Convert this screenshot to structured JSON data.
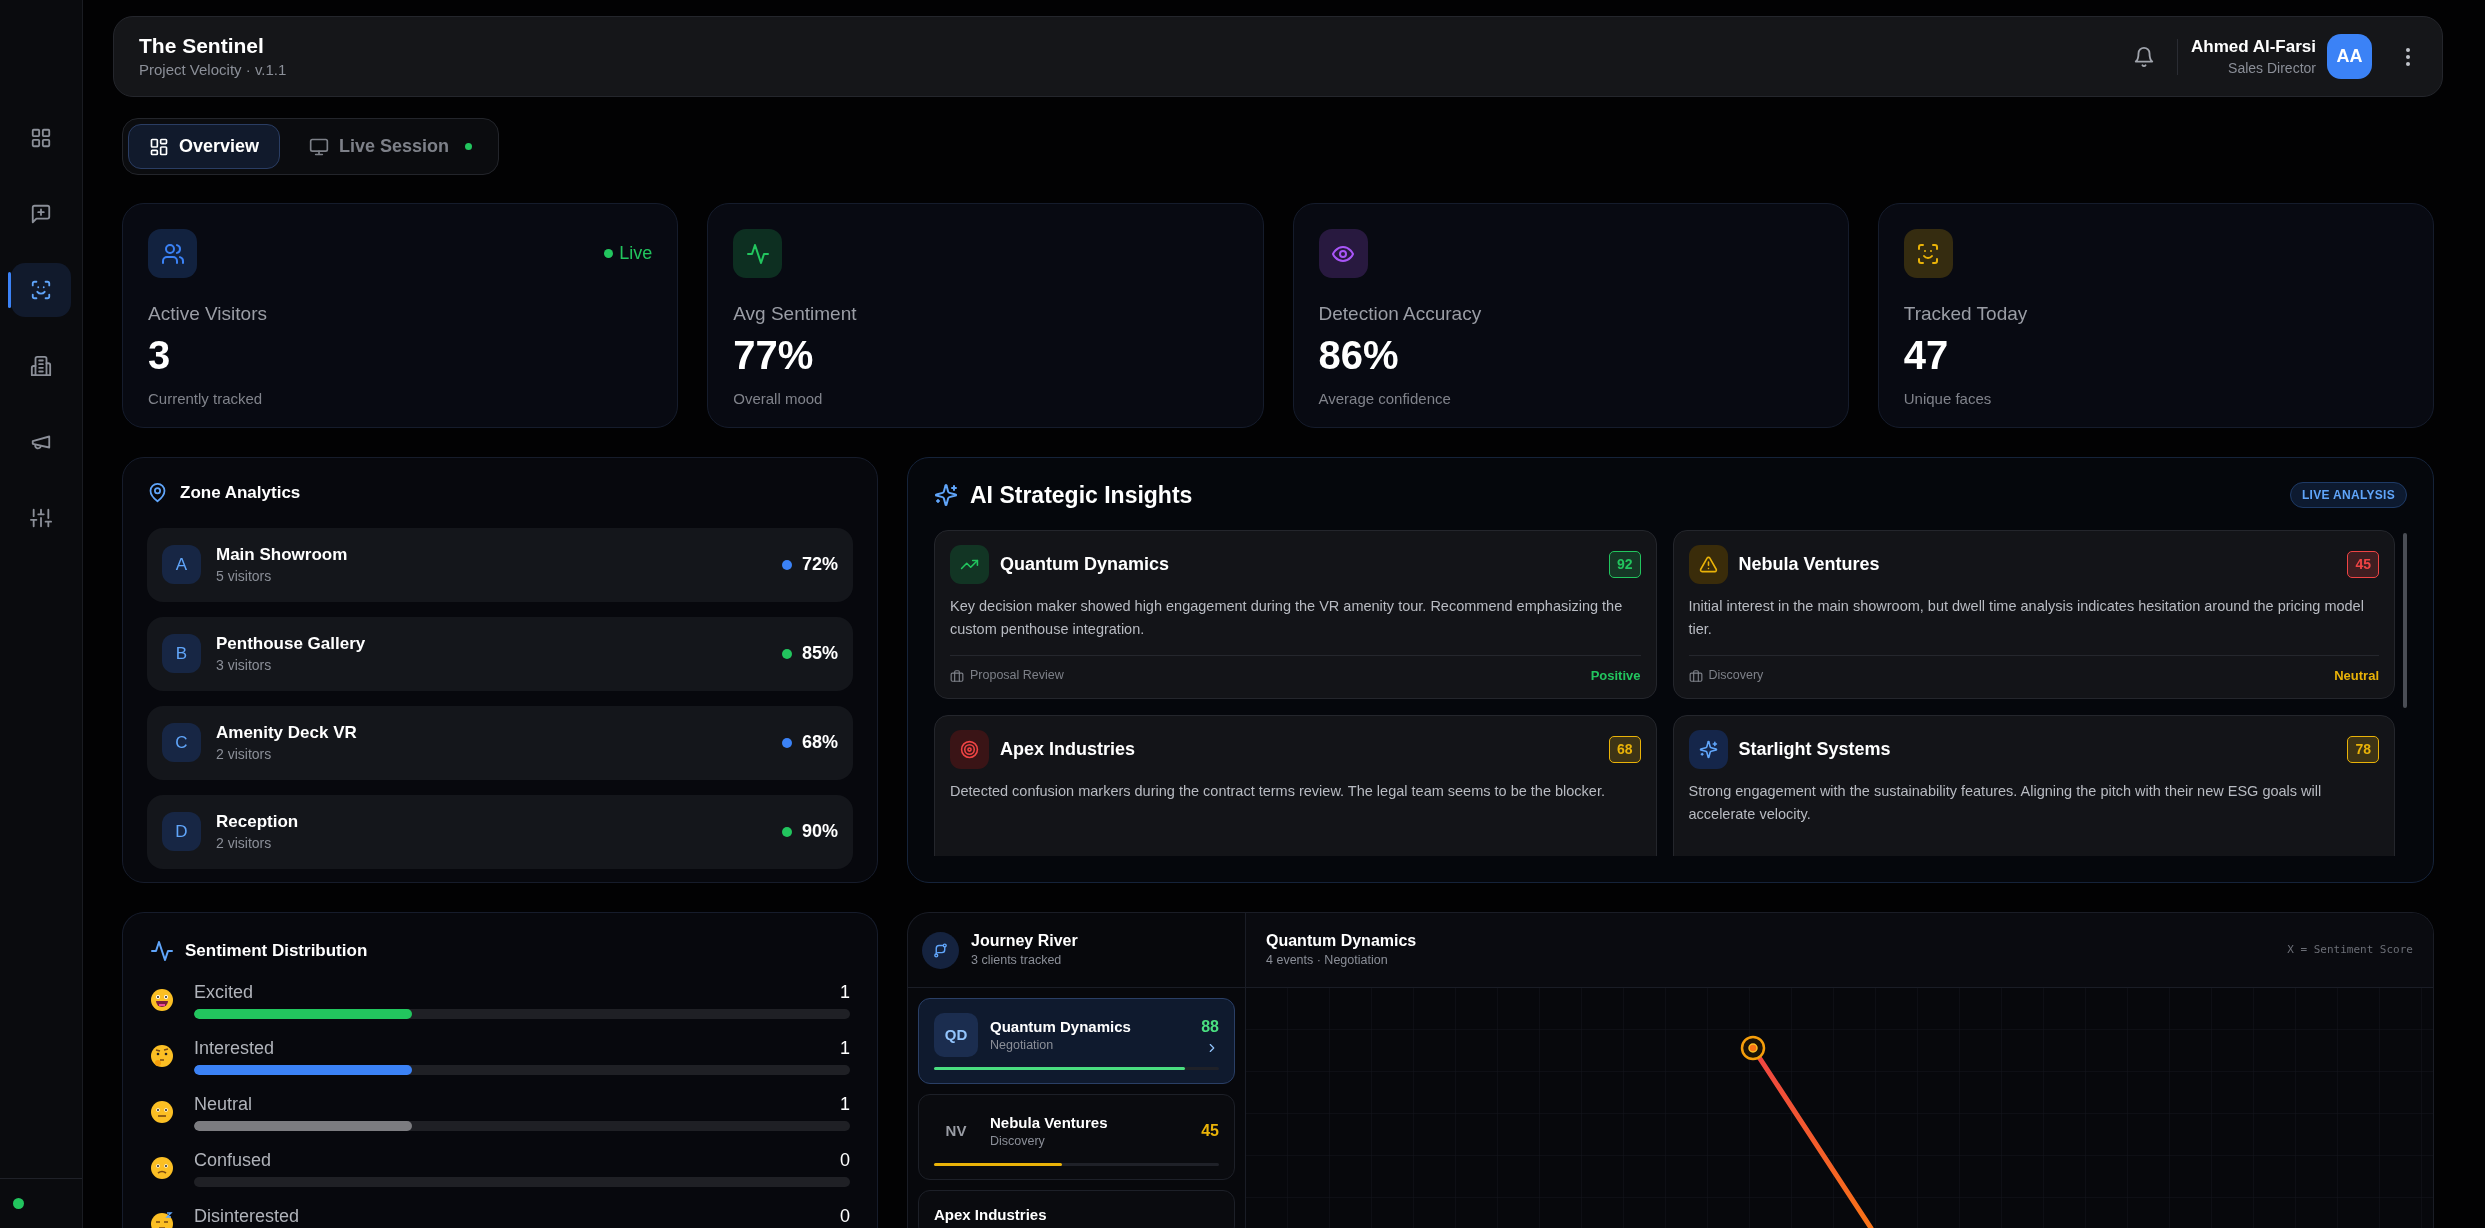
{
  "sidebar": {
    "items": [
      {
        "selected": false
      },
      {
        "selected": false
      },
      {
        "selected": true
      },
      {
        "selected": false
      },
      {
        "selected": false
      },
      {
        "selected": false
      }
    ]
  },
  "header": {
    "title": "The Sentinel",
    "subtitle": "Project Velocity · v.1.1",
    "user": {
      "name": "Ahmed Al-Farsi",
      "role": "Sales Director",
      "initials": "AA"
    }
  },
  "tabs": [
    {
      "label": "Overview",
      "selected": true,
      "live": false
    },
    {
      "label": "Live Session",
      "selected": false,
      "live": true
    }
  ],
  "stats": [
    {
      "label": "Active Visitors",
      "value": "3",
      "caption": "Currently tracked",
      "color": "#3b82f6",
      "badge": "Live"
    },
    {
      "label": "Avg Sentiment",
      "value": "77%",
      "caption": "Overall mood",
      "color": "#22c55e"
    },
    {
      "label": "Detection Accuracy",
      "value": "86%",
      "caption": "Average confidence",
      "color": "#a855f7"
    },
    {
      "label": "Tracked Today",
      "value": "47",
      "caption": "Unique faces",
      "color": "#eab308"
    }
  ],
  "zones": {
    "title": "Zone Analytics",
    "items": [
      {
        "letter": "A",
        "name": "Main Showroom",
        "visitors": "5 visitors",
        "percent": "72%",
        "color": "#3b82f6"
      },
      {
        "letter": "B",
        "name": "Penthouse Gallery",
        "visitors": "3 visitors",
        "percent": "85%",
        "color": "#22c55e"
      },
      {
        "letter": "C",
        "name": "Amenity Deck VR",
        "visitors": "2 visitors",
        "percent": "68%",
        "color": "#3b82f6"
      },
      {
        "letter": "D",
        "name": "Reception",
        "visitors": "2 visitors",
        "percent": "90%",
        "color": "#22c55e"
      }
    ]
  },
  "insights": {
    "title": "AI Strategic Insights",
    "badge": "LIVE ANALYSIS",
    "cards": [
      {
        "kind": "trend",
        "company": "Quantum Dynamics",
        "score": "92",
        "color": "#22c55e",
        "text": "Key decision maker showed high engagement during the VR amenity tour. Recommend emphasizing the custom penthouse integration.",
        "stage": "Proposal Review",
        "sentiment": {
          "label": "Positive",
          "color": "#22c55e"
        }
      },
      {
        "kind": "warning",
        "company": "Nebula Ventures",
        "score": "45",
        "color": "#ef4444",
        "text": "Initial interest in the main showroom, but dwell time analysis indicates hesitation around the pricing model tier.",
        "stage": "Discovery",
        "sentiment": {
          "label": "Neutral",
          "color": "#eab308"
        }
      },
      {
        "kind": "target",
        "company": "Apex Industries",
        "score": "68",
        "color": "#eab308",
        "text": "Detected confusion markers during the contract terms review. The legal team seems to be the blocker."
      },
      {
        "kind": "sparkle",
        "company": "Starlight Systems",
        "score": "78",
        "color": "#eab308",
        "text": "Strong engagement with the sustainability features. Aligning the pitch with their new ESG goals will accelerate velocity."
      }
    ]
  },
  "sentiment": {
    "title": "Sentiment Distribution",
    "items": [
      {
        "kind": "excited",
        "label": "Excited",
        "count": "1",
        "level": 0.333,
        "color": "#22c55e"
      },
      {
        "kind": "interested",
        "label": "Interested",
        "count": "1",
        "level": 0.333,
        "color": "#3b82f6"
      },
      {
        "kind": "neutral",
        "label": "Neutral",
        "count": "1",
        "level": 0.333,
        "color": "#7c7c80"
      },
      {
        "kind": "confused",
        "label": "Confused",
        "count": "0"
      },
      {
        "kind": "disinterested",
        "label": "Disinterested",
        "count": "0"
      }
    ]
  },
  "journey": {
    "title": "Journey River",
    "subtitle": "3 clients tracked",
    "clients": [
      {
        "initials": "QD",
        "name": "Quantum Dynamics",
        "stage": "Negotiation",
        "score": "88",
        "level": 0.88,
        "color": "#4ade80",
        "selected": true
      },
      {
        "initials": "NV",
        "name": "Nebula Ventures",
        "stage": "Discovery",
        "score": "45",
        "level": 0.45,
        "color": "#eab308",
        "selected": false
      },
      {
        "name": "Apex Industries",
        "selected": false
      }
    ],
    "detail": {
      "title": "Quantum Dynamics",
      "subtitle": "4 events · Negotiation",
      "legend": "X = Sentiment Score"
    }
  }
}
